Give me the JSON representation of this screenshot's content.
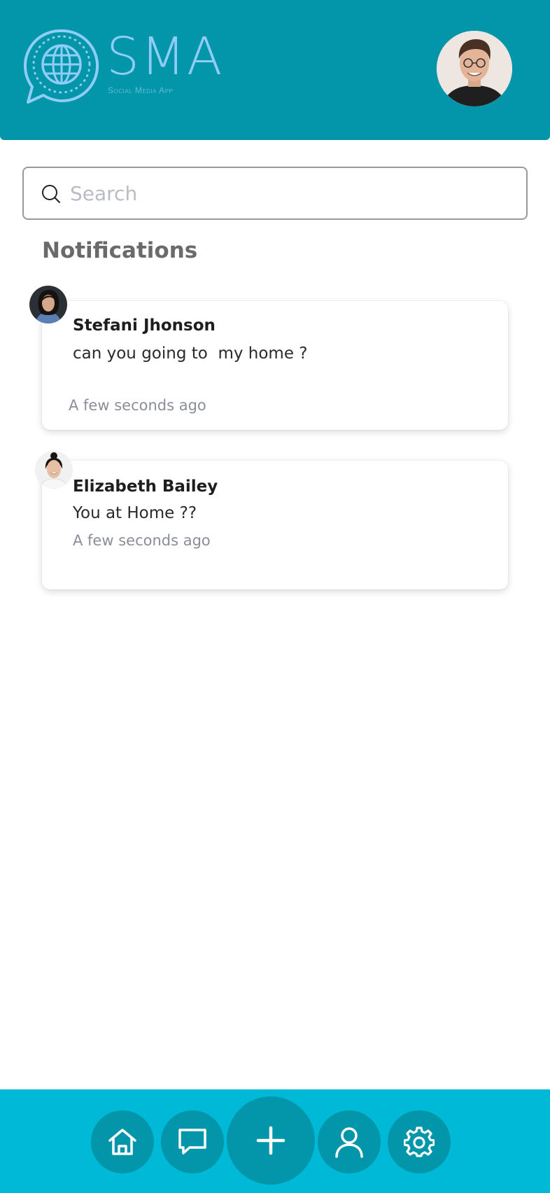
{
  "header": {
    "logo_title": "SMA",
    "logo_subtitle": "Social Media App"
  },
  "search": {
    "placeholder": "Search",
    "value": ""
  },
  "notifications": {
    "title": "Notifications",
    "items": [
      {
        "name": "Stefani Jhonson",
        "message": "can you going to  my home ?",
        "time": "A few seconds ago"
      },
      {
        "name": "Elizabeth Bailey",
        "message": "You at Home ??",
        "time": "A few seconds ago"
      }
    ]
  },
  "nav": {
    "items": [
      "home-icon",
      "chat-icon",
      "add-icon",
      "profile-icon",
      "settings-icon"
    ]
  },
  "colors": {
    "header_bg": "#0395a9",
    "nav_bg": "#00b9d6",
    "nav_button_bg": "#0395a9",
    "logo": "#8fcdf6"
  }
}
